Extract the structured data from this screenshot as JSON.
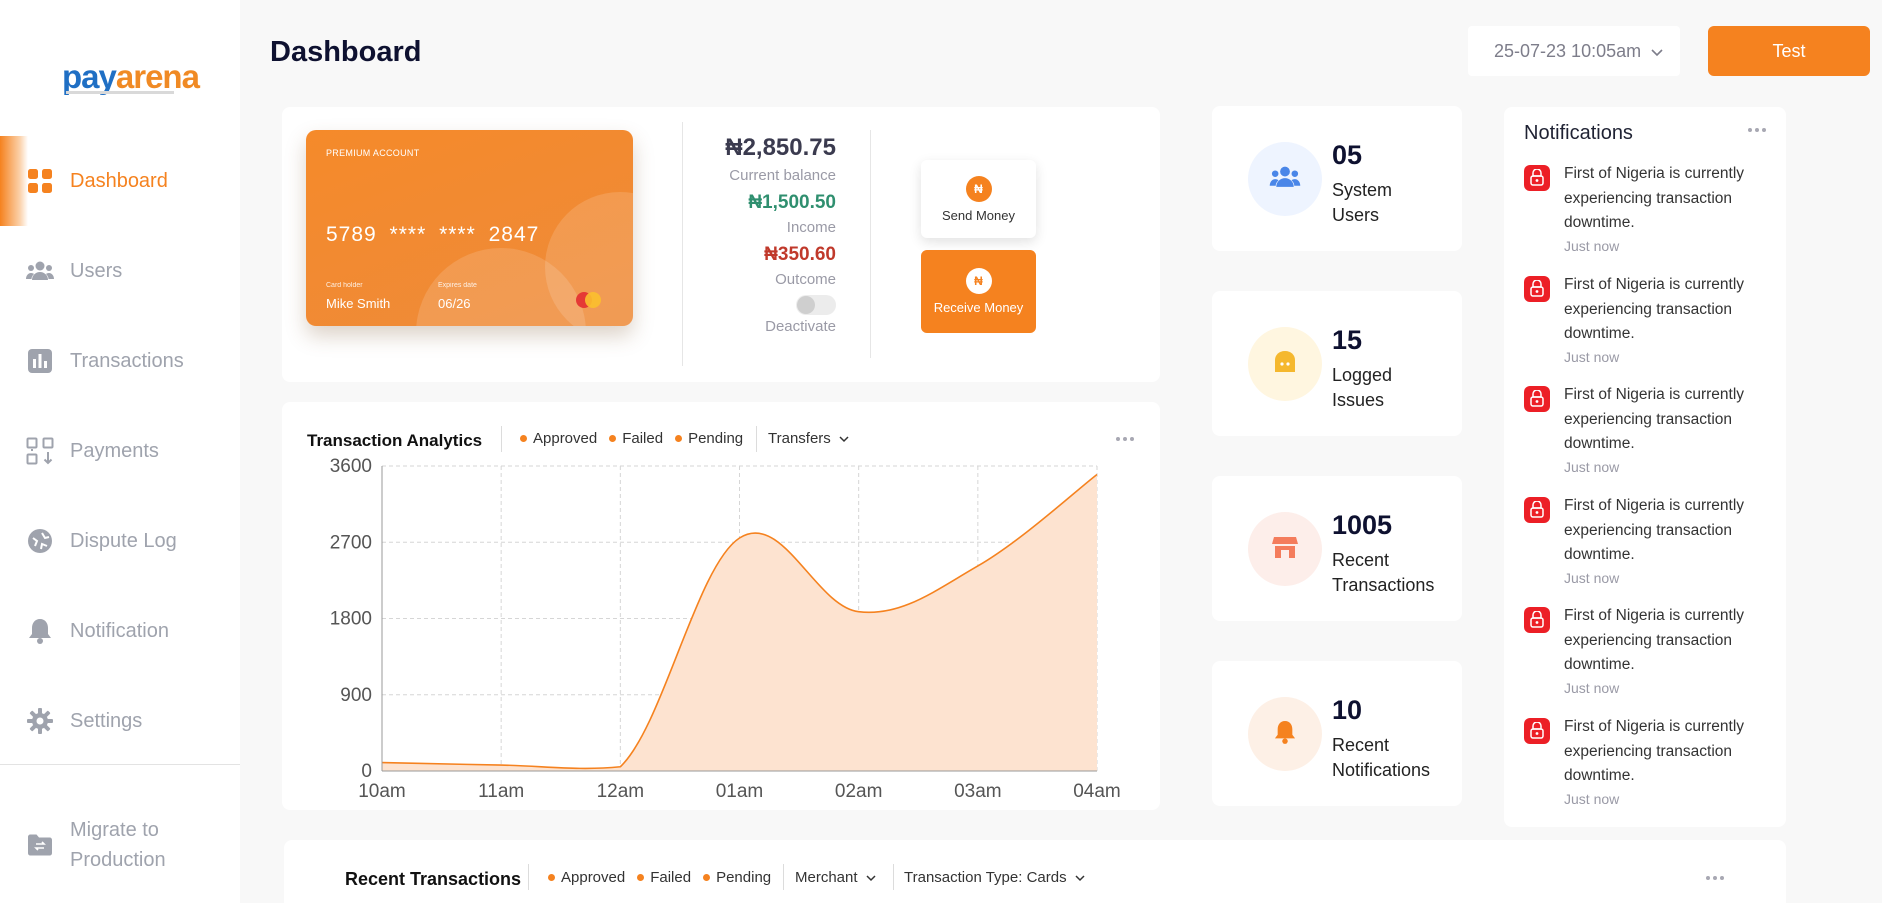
{
  "brand": {
    "logo_pay": "pay",
    "logo_arena": "arena"
  },
  "sidebar": {
    "items": [
      {
        "label": "Dashboard",
        "icon": "grid-icon",
        "active": true
      },
      {
        "label": "Users",
        "icon": "users-icon"
      },
      {
        "label": "Transactions",
        "icon": "bar-chart-icon"
      },
      {
        "label": "Payments",
        "icon": "payments-icon"
      },
      {
        "label": "Dispute Log",
        "icon": "dispute-icon"
      },
      {
        "label": "Notification",
        "icon": "bell-icon"
      },
      {
        "label": "Settings",
        "icon": "gear-icon"
      }
    ],
    "migrate": {
      "line1": "Migrate to",
      "line2": "Production",
      "icon": "folder-swap-icon"
    }
  },
  "header": {
    "title": "Dashboard",
    "date_value": "25-07-23 10:05am",
    "test_button": "Test"
  },
  "colors": {
    "accent": "#f5821f",
    "income": "#2f8f6f",
    "outcome": "#c0392b",
    "alert": "#ec1f26"
  },
  "card": {
    "type_label": "PREMIUM ACCOUNT",
    "number": "5789 **** **** 2847",
    "holder_label": "Card holder",
    "holder": "Mike Smith",
    "expires_label": "Expires date",
    "expires": "06/26"
  },
  "balances": {
    "current": "₦2,850.75",
    "current_label": "Current balance",
    "income": "₦1,500.50",
    "income_label": "Income",
    "outcome": "₦350.60",
    "outcome_label": "Outcome",
    "deactivate_label": "Deactivate",
    "deactivate_on": false
  },
  "actions": {
    "send": "Send Money",
    "receive": "Receive Money",
    "naira_glyph": "₦"
  },
  "analytics": {
    "title": "Transaction Analytics",
    "legend": [
      "Approved",
      "Failed",
      "Pending"
    ],
    "filter": "Transfers"
  },
  "chart_data": {
    "type": "area",
    "x": [
      "10am",
      "11am",
      "12am",
      "01am",
      "02am",
      "03am",
      "04am"
    ],
    "y_ticks": [
      0,
      900,
      1800,
      2700,
      3600
    ],
    "ylim": [
      0,
      3600
    ],
    "values": [
      100,
      70,
      50,
      2750,
      1880,
      2420,
      3500
    ],
    "grid": true
  },
  "stats": [
    {
      "number": "05",
      "line1": "System",
      "line2": "Users",
      "icon": "users-icon",
      "bg": "#eef4ff",
      "fg": "#3b82f6"
    },
    {
      "number": "15",
      "line1": "Logged",
      "line2": "Issues",
      "icon": "issues-icon",
      "bg": "#fff6e0",
      "fg": "#f5b82e"
    },
    {
      "number": "1005",
      "line1": "Recent",
      "line2": "Transactions",
      "icon": "store-icon",
      "bg": "#fdeeea",
      "fg": "#f47c5c"
    },
    {
      "number": "10",
      "line1": "Recent",
      "line2": "Notifications",
      "icon": "bell-icon",
      "bg": "#fdf0e6",
      "fg": "#f5821f"
    }
  ],
  "notifications": {
    "title": "Notifications",
    "items": [
      {
        "line1": "First of Nigeria is currently",
        "line2": "experiencing transaction",
        "line3": "downtime.",
        "time": "Just now"
      },
      {
        "line1": "First of Nigeria is currently",
        "line2": "experiencing transaction",
        "line3": "downtime.",
        "time": "Just now"
      },
      {
        "line1": "First of Nigeria is currently",
        "line2": "experiencing transaction",
        "line3": "downtime.",
        "time": "Just now"
      },
      {
        "line1": "First of Nigeria is currently",
        "line2": "experiencing transaction",
        "line3": "downtime.",
        "time": "Just now"
      },
      {
        "line1": "First of Nigeria is currently",
        "line2": "experiencing transaction",
        "line3": "downtime.",
        "time": "Just now"
      },
      {
        "line1": "First of Nigeria is currently",
        "line2": "experiencing transaction",
        "line3": "downtime.",
        "time": "Just now"
      }
    ]
  },
  "recent": {
    "title": "Recent Transactions",
    "legend": [
      "Approved",
      "Failed",
      "Pending"
    ],
    "filter_merchant": "Merchant",
    "filter_type": "Transaction Type: Cards"
  }
}
